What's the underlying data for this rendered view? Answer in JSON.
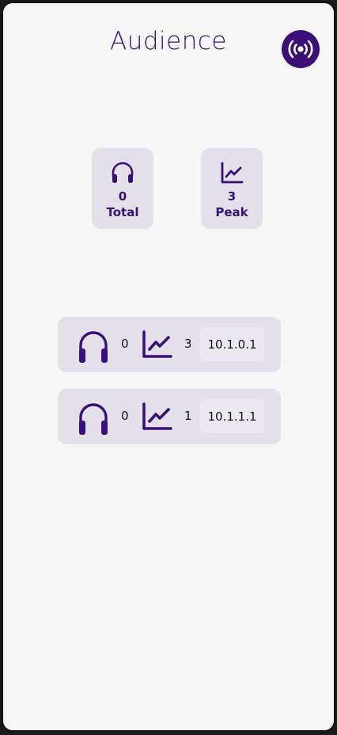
{
  "header": {
    "title": "Audience",
    "live_icon": "broadcast-icon"
  },
  "summary": {
    "total": {
      "icon": "headphones-icon",
      "value": "0",
      "label": "Total"
    },
    "peak": {
      "icon": "line-chart-icon",
      "value": "3",
      "label": "Peak"
    }
  },
  "streams": [
    {
      "listeners": "0",
      "peak": "3",
      "ip": "10.1.0.1"
    },
    {
      "listeners": "0",
      "peak": "1",
      "ip": "10.1.1.1"
    }
  ],
  "colors": {
    "accent": "#3a1078",
    "card": "#e3e0e9",
    "background": "#f6f6f6"
  }
}
